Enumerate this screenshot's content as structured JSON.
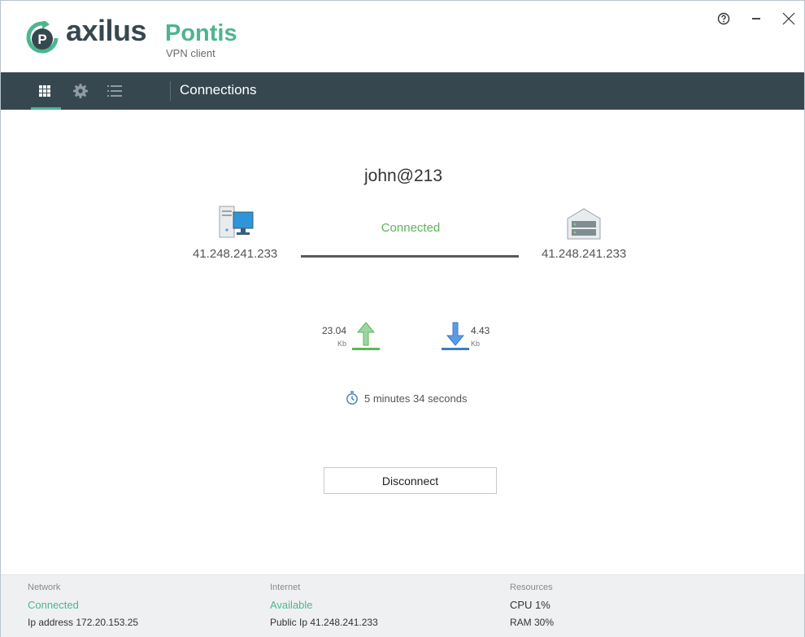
{
  "app": {
    "brand": "axilus",
    "product": "Pontis",
    "subtitle": "VPN client",
    "brand_color": "#37474f",
    "accent_color": "#4cb68d"
  },
  "window_controls": {
    "help_icon": "help-circle-icon",
    "minimize_icon": "minimize-icon",
    "close_icon": "close-icon"
  },
  "nav": {
    "icons": [
      "grid-icon",
      "gear-icon",
      "list-icon"
    ],
    "active": "grid-icon",
    "title": "Connections"
  },
  "connection": {
    "name": "john@213",
    "status": "Connected",
    "local_ip": "41.248.241.233",
    "remote_ip": "41.248.241.233",
    "local_icon": "computer-icon",
    "remote_icon": "server-icon"
  },
  "transfer": {
    "upload_value": "23.04",
    "upload_unit": "Kb",
    "download_value": "4.43",
    "download_unit": "Kb"
  },
  "timer": {
    "icon": "stopwatch-icon",
    "text": "5 minutes 34 seconds"
  },
  "disconnect_label": "Disconnect",
  "footer": {
    "network": {
      "label": "Network",
      "status": "Connected",
      "detail": "Ip address 172.20.153.25"
    },
    "internet": {
      "label": "Internet",
      "status": "Available",
      "detail": "Public Ip 41.248.241.233"
    },
    "resources": {
      "label": "Resources",
      "cpu": "CPU 1%",
      "ram": "RAM 30%"
    }
  }
}
